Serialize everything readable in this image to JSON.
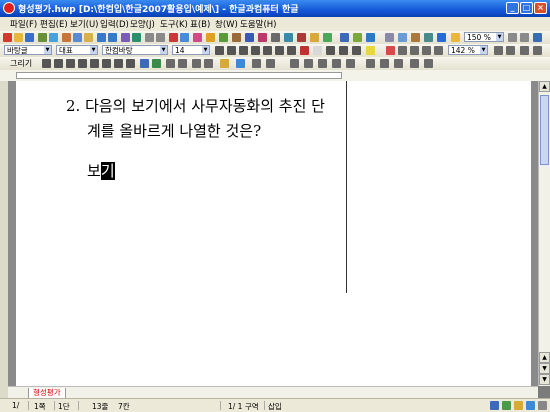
{
  "window": {
    "title": "형성평가.hwp [D:\\한컴입\\한글2007활용입\\예제\\] - 한글과컴퓨터 한글",
    "minimize": "_",
    "maximize": "□",
    "close": "×"
  },
  "menu": [
    "파일(F)",
    "편집(E)",
    "보기(U)",
    "입력(D)",
    "모양(J)",
    "도구(K)",
    "표(B)",
    "창(W)",
    "도움말(H)"
  ],
  "toolbar": {
    "zoom": "150 %",
    "style": "바탕글",
    "lang": "대표",
    "font": "한컴바탕",
    "size": "14",
    "charspace": "142 %",
    "draw_label": "그리기"
  },
  "document": {
    "line1": "2.  다음의  보기에서  사무자동화의  추진  단",
    "line2": "계를 올바르게 나열한 것은?",
    "line3_prefix": "보",
    "line3_cursor": "기"
  },
  "doc_tab": "형성평가",
  "status": {
    "page": "1/",
    "page_num": "1쪽",
    "section": "1단",
    "line": "13줄",
    "col": "7칸",
    "section_info": "1/   1 구역",
    "mode": "삽입"
  },
  "colors": {
    "titlebar": "#1458d8",
    "menubar": "#ece9d8",
    "doc_background": "#8a8a8a",
    "page": "#ffffff"
  }
}
